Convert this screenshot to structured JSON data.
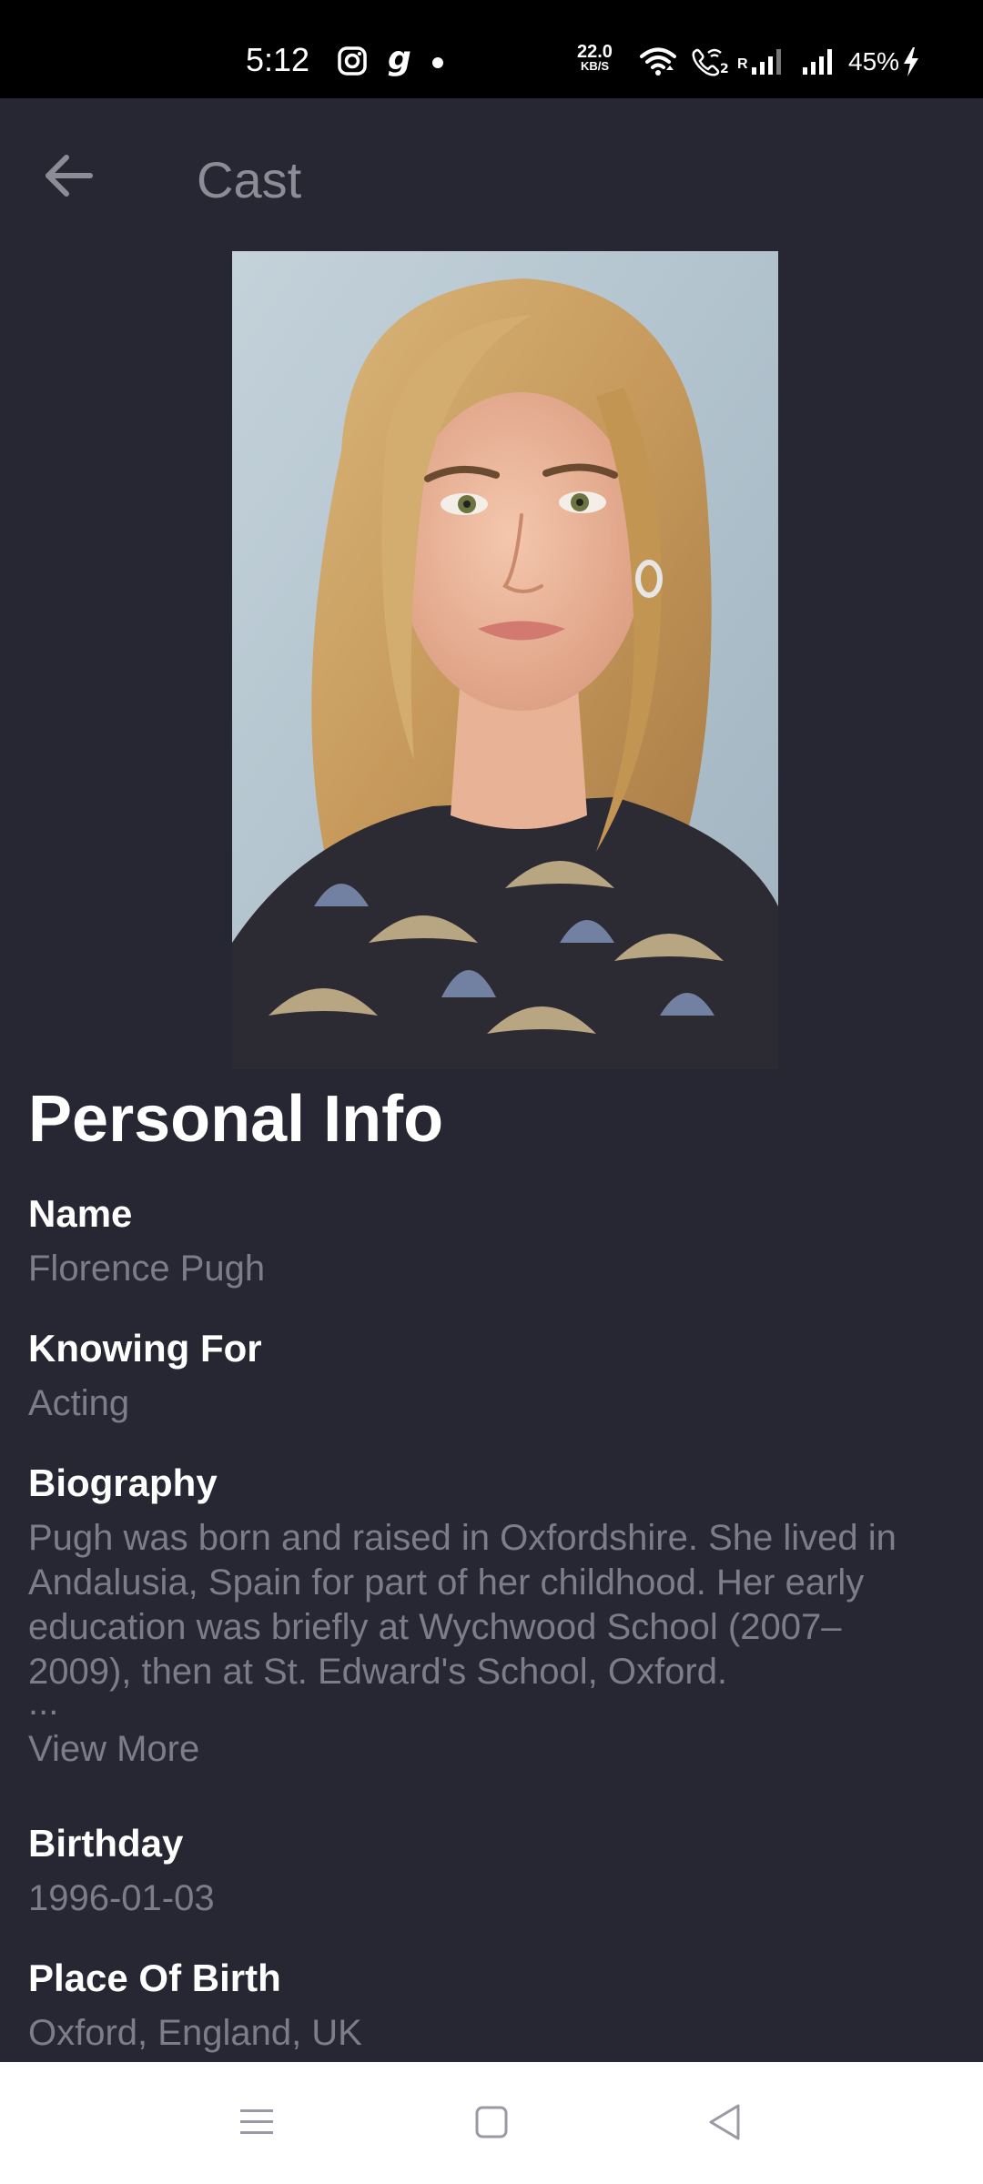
{
  "status_bar": {
    "time": "5:12",
    "net_speed_value": "22.0",
    "net_speed_unit": "KB/S",
    "roaming_label": "R",
    "battery": "45%",
    "icons": [
      "instagram-icon",
      "g-app-icon",
      "dot-icon",
      "wifi-icon",
      "wifi-calling-icon",
      "signal-icon",
      "signal-icon",
      "charging-icon"
    ]
  },
  "app_bar": {
    "title": "Cast",
    "back_icon": "arrow-left-icon"
  },
  "profile": {
    "photo_alt": "Florence Pugh"
  },
  "personal_info": {
    "heading": "Personal Info",
    "name_label": "Name",
    "name_value": "Florence Pugh",
    "known_for_label": "Knowing For",
    "known_for_value": "Acting",
    "biography_label": "Biography",
    "biography_value": "Pugh was born and raised in Oxfordshire. She lived in Andalusia, Spain for part of her childhood. Her early education was briefly at Wychwood School (2007–2009), then at St. Edward's School, Oxford.",
    "biography_ellipsis": "...",
    "view_more": "View More",
    "birthday_label": "Birthday",
    "birthday_value": "1996-01-03",
    "place_of_birth_label": "Place Of Birth",
    "place_of_birth_value": "Oxford, England, UK"
  },
  "nav_bar": {
    "icons": [
      "menu-icon",
      "home-square-icon",
      "back-triangle-icon"
    ]
  },
  "colors": {
    "background": "#272733",
    "status_bar": "#000000",
    "label": "#ffffff",
    "value": "#7d7d89",
    "title": "#8c8c96",
    "nav_bar": "#ffffff"
  }
}
